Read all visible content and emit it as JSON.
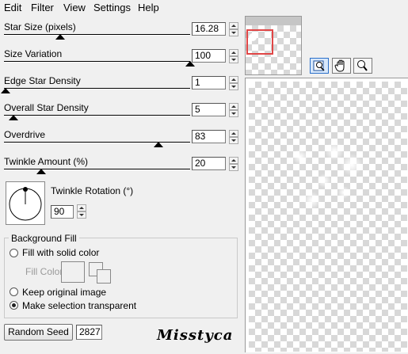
{
  "menu": {
    "items": [
      "Edit",
      "Filter",
      "View",
      "Settings",
      "Help"
    ]
  },
  "sliders": [
    {
      "label": "Star Size (pixels)",
      "value": "16.28",
      "level": 0.3
    },
    {
      "label": "Size Variation",
      "value": "100",
      "level": 1.0
    },
    {
      "label": "Edge Star Density",
      "value": "1",
      "level": 0.01
    },
    {
      "label": "Overall Star Density",
      "value": "5",
      "level": 0.05
    },
    {
      "label": "Overdrive",
      "value": "83",
      "level": 0.83
    },
    {
      "label": "Twinkle Amount (%)",
      "value": "20",
      "level": 0.2
    }
  ],
  "rotation": {
    "label": "Twinkle Rotation (°)",
    "value": "90"
  },
  "background_fill": {
    "title": "Background Fill",
    "options": [
      {
        "label": "Fill with solid color",
        "selected": false
      },
      {
        "label": "Keep original image",
        "selected": false
      },
      {
        "label": "Make selection transparent",
        "selected": true
      }
    ],
    "fill_color_label": "Fill Color"
  },
  "random_seed": {
    "button_label": "Random Seed",
    "value": "2827"
  },
  "watermark": {
    "text": "Misstyca"
  },
  "preview_tools": [
    {
      "icon": "zoom-fit-icon",
      "active": true
    },
    {
      "icon": "hand-pan-icon",
      "active": false
    },
    {
      "icon": "magnifier-icon",
      "active": false
    }
  ],
  "colors": {
    "selection_rect": "#e04646",
    "tool_active": "#2a6fc9"
  }
}
